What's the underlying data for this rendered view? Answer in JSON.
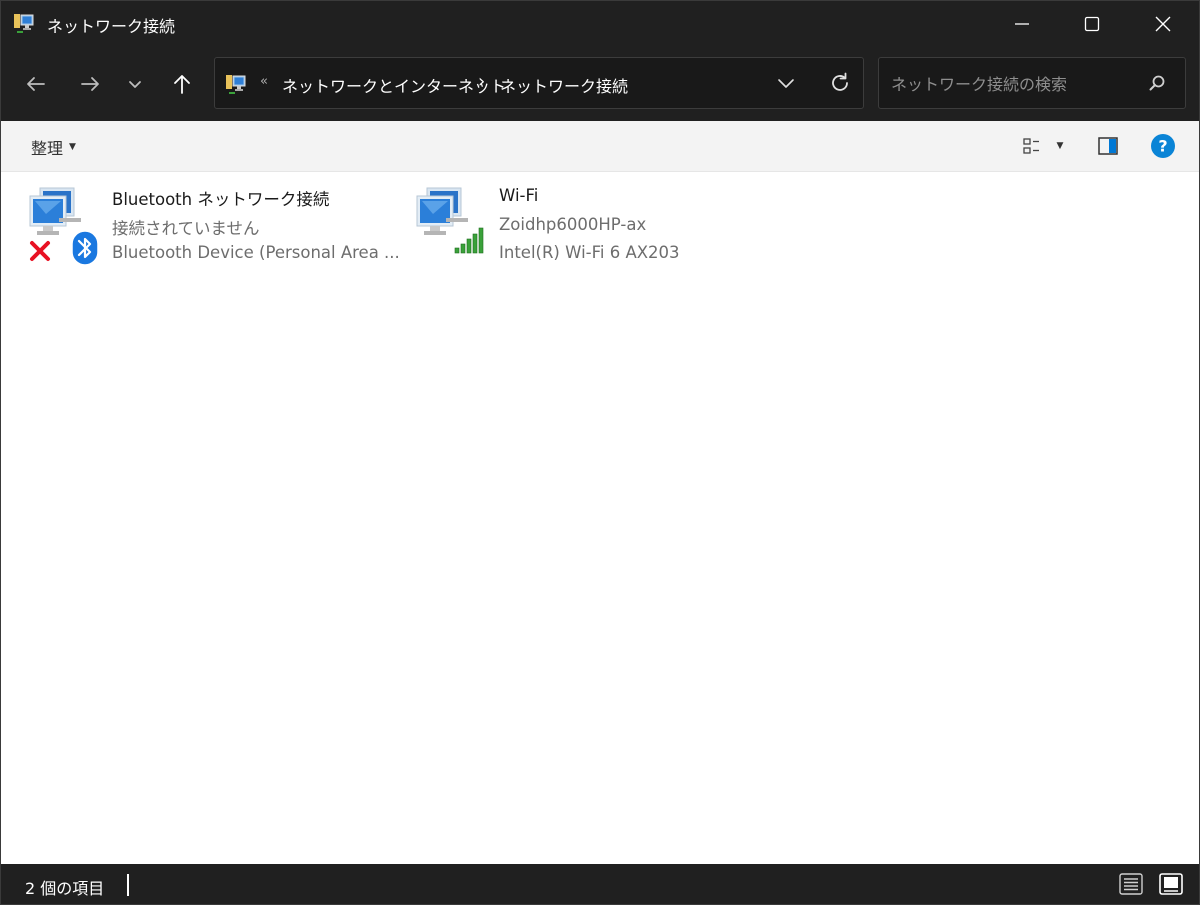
{
  "window": {
    "title": "ネットワーク接続"
  },
  "nav": {
    "back_icon": "arrow-left-icon",
    "forward_icon": "arrow-right-icon",
    "recent_icon": "chevron-down-icon",
    "up_icon": "arrow-up-icon"
  },
  "address": {
    "overflow": "«",
    "crumbs": [
      "ネットワークとインターネット",
      "ネットワーク接続"
    ],
    "separator": "›"
  },
  "search": {
    "placeholder": "ネットワーク接続の検索"
  },
  "toolbar": {
    "organize_label": "整理"
  },
  "connections": [
    {
      "name": "Bluetooth ネットワーク接続",
      "status": "接続されていません",
      "device": "Bluetooth Device (Personal Area ...",
      "overlay_icon": "bluetooth-icon",
      "state_icon": "disconnected-x-icon"
    },
    {
      "name": "Wi-Fi",
      "status": "Zoidhp6000HP-ax",
      "device": "Intel(R) Wi-Fi 6 AX203",
      "overlay_icon": "signal-bars-icon"
    }
  ],
  "statusbar": {
    "item_count": "2 個の項目"
  },
  "colors": {
    "chrome": "#202020",
    "content_bg": "#ffffff",
    "accent_blue": "#0078d4",
    "signal_green": "#3aa13a",
    "error_red": "#e81123"
  }
}
